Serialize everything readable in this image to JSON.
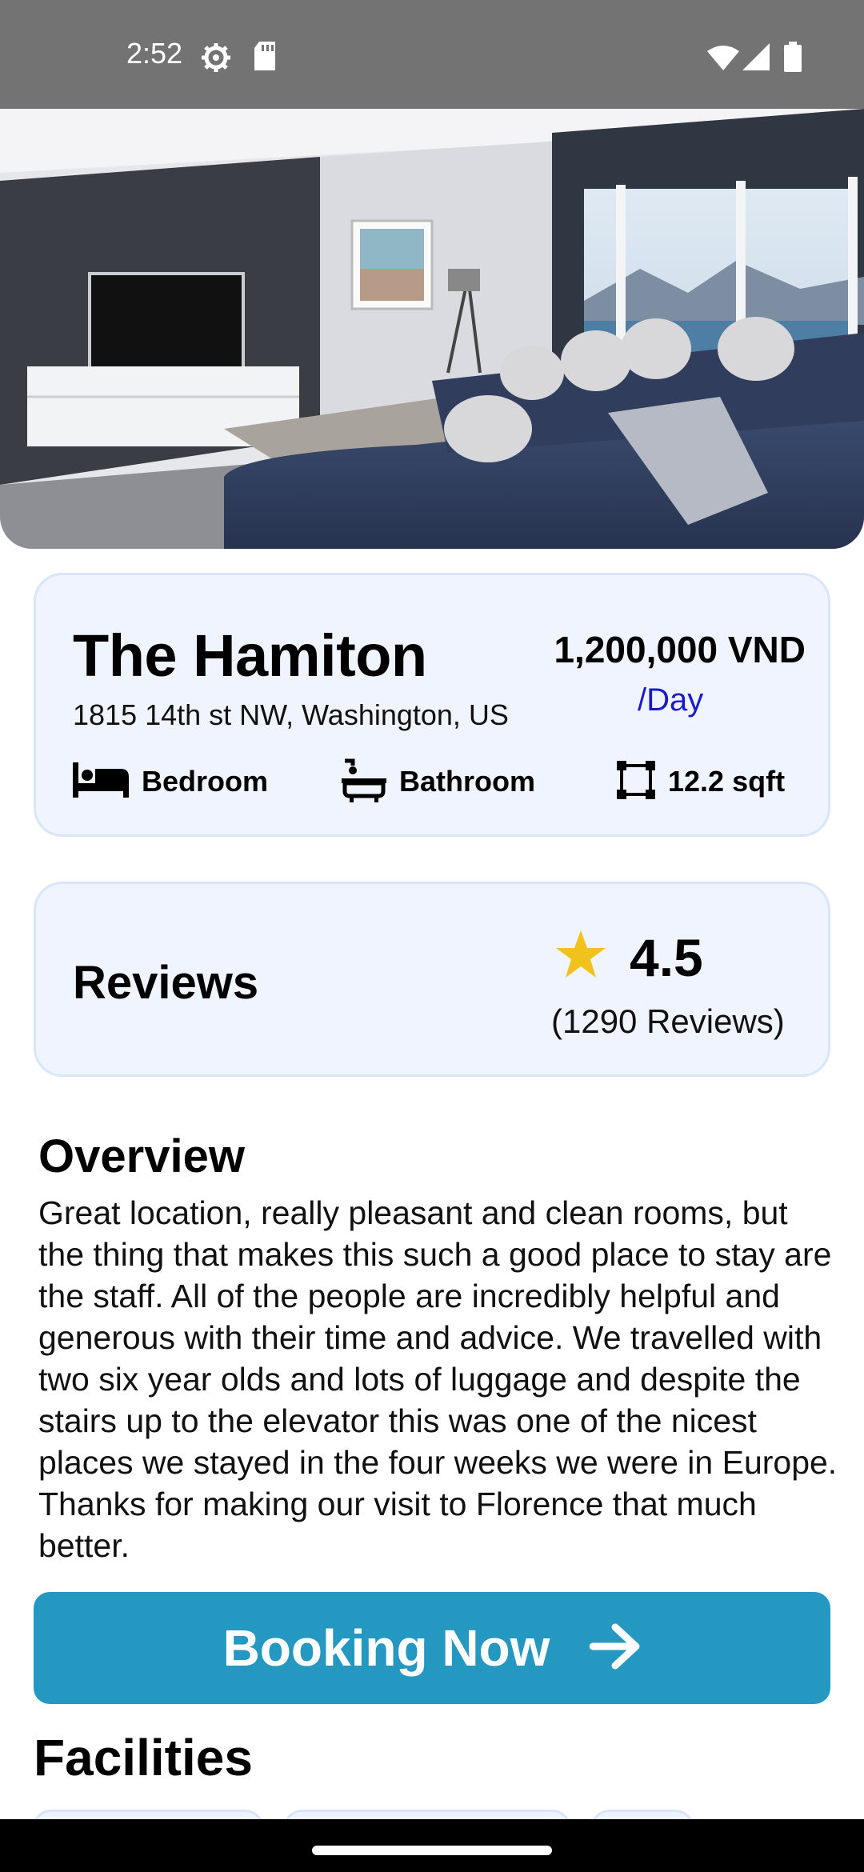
{
  "status_bar": {
    "time": "2:52",
    "icons": [
      "settings-gear-icon",
      "sd-card-icon",
      "wifi-icon",
      "cell-signal-icon",
      "battery-icon"
    ]
  },
  "hero": {
    "image": "living-room-photo"
  },
  "property": {
    "name": "The Hamiton",
    "address": "1815 14th st NW, Washington, US",
    "price": "1,200,000 VND",
    "price_unit": "/Day",
    "features": [
      {
        "icon": "bed-icon",
        "label": "Bedroom"
      },
      {
        "icon": "bathtub-icon",
        "label": "Bathroom"
      },
      {
        "icon": "area-icon",
        "label": "12.2 sqft"
      }
    ]
  },
  "reviews": {
    "title": "Reviews",
    "rating": "4.5",
    "count": "(1290 Reviews)",
    "star_color": "#f1c21b"
  },
  "overview": {
    "title": "Overview",
    "text": "Great location, really pleasant and clean rooms, but the thing that makes this such a good place to stay are the staff. All of the people are incredibly helpful and generous with their time and advice. We travelled with two six year olds and lots of luggage and despite the stairs up to the elevator this was one of the nicest places we stayed in the four weeks we were in Europe. Thanks for making our visit to Florence that much better."
  },
  "booking": {
    "label": "Booking Now",
    "icon": "arrow-right-icon",
    "color": "#2598c2"
  },
  "facilities": {
    "title": "Facilities"
  }
}
